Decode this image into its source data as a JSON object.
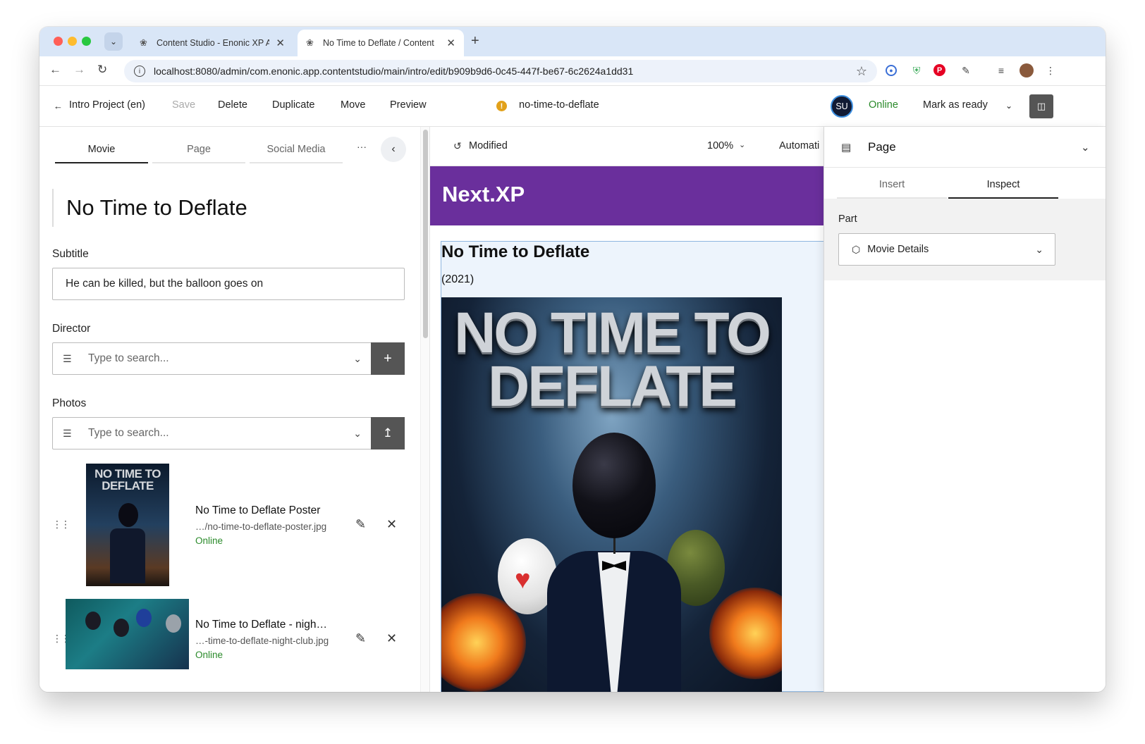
{
  "browser": {
    "tabs": [
      {
        "title": "Content Studio - Enonic XP A",
        "active": false
      },
      {
        "title": "No Time to Deflate / Content",
        "active": true
      }
    ],
    "url": "localhost:8080/admin/com.enonic.app.contentstudio/main/intro/edit/b909b9d6-0c45-447f-be67-6c2624a1dd31"
  },
  "toolbar": {
    "back_label": "Intro Project (en)",
    "save_label": "Save",
    "delete_label": "Delete",
    "duplicate_label": "Duplicate",
    "move_label": "Move",
    "preview_label": "Preview",
    "content_path": "no-time-to-deflate",
    "avatar_initials": "SU",
    "status": "Online",
    "mark_ready_label": "Mark as ready"
  },
  "form": {
    "tabs": [
      "Movie",
      "Page",
      "Social Media"
    ],
    "active_tab": "Movie",
    "more_label": "···",
    "display_name": "No Time to Deflate",
    "subtitle_label": "Subtitle",
    "subtitle_value": "He can be killed, but the balloon goes on",
    "director_label": "Director",
    "director_placeholder": "Type to search...",
    "photos_label": "Photos",
    "photos_placeholder": "Type to search...",
    "photos": [
      {
        "name": "No Time to Deflate Poster",
        "path": "…/no-time-to-deflate-poster.jpg",
        "status": "Online"
      },
      {
        "name": "No Time to Deflate - nigh…",
        "path": "…-time-to-deflate-night-club.jpg",
        "status": "Online"
      }
    ],
    "poster_thumb_text": [
      "NO TIME TO",
      "DEFLATE"
    ]
  },
  "preview": {
    "status": "Modified",
    "zoom": "100%",
    "device": "Automati",
    "site_logo": "Next.XP",
    "movie_title": "No Time to Deflate",
    "movie_year": "(2021)",
    "poster_line1": "NO TIME TO",
    "poster_line2": "DEFLATE"
  },
  "inspect": {
    "title": "Page",
    "tabs": [
      "Insert",
      "Inspect"
    ],
    "active_tab": "Inspect",
    "part_label": "Part",
    "part_value": "Movie Details"
  },
  "colors": {
    "site_header": "#6a2f9c",
    "online": "#2a8a2a",
    "warning": "#e2a11a",
    "tabstrip": "#d9e6f7"
  }
}
